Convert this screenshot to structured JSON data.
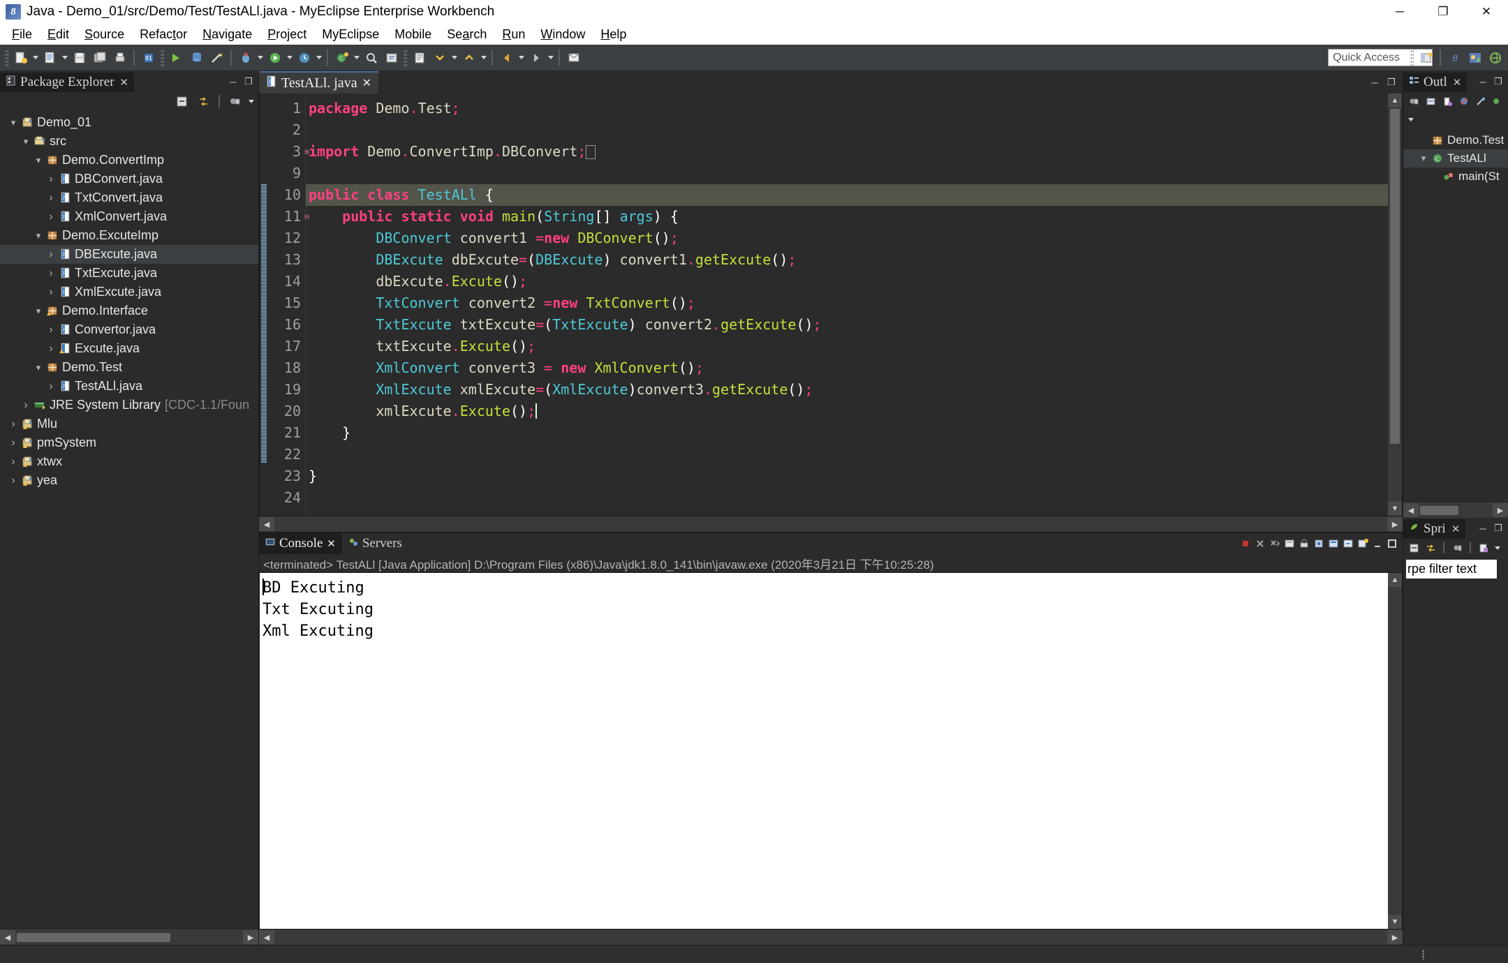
{
  "window": {
    "title": "Java - Demo_01/src/Demo/Test/TestALl.java - MyEclipse Enterprise Workbench",
    "app_icon": "myeclipse-icon",
    "minimize": "─",
    "maximize": "❐",
    "close": "✕"
  },
  "menu": [
    {
      "label": "File",
      "accel": "F"
    },
    {
      "label": "Edit",
      "accel": "E"
    },
    {
      "label": "Source",
      "accel": "S"
    },
    {
      "label": "Refactor",
      "accel": "t"
    },
    {
      "label": "Navigate",
      "accel": "N"
    },
    {
      "label": "Project",
      "accel": "P"
    },
    {
      "label": "MyEclipse",
      "accel": ""
    },
    {
      "label": "Mobile",
      "accel": ""
    },
    {
      "label": "Search",
      "accel": "a"
    },
    {
      "label": "Run",
      "accel": "R"
    },
    {
      "label": "Window",
      "accel": "W"
    },
    {
      "label": "Help",
      "accel": "H"
    }
  ],
  "toolbar": {
    "quick_access_placeholder": "Quick Access"
  },
  "package_explorer": {
    "tab_label": "Package Explorer",
    "close_glyph": "✕",
    "minimize_glyph": "─",
    "maximize_glyph": "❐",
    "tree": [
      {
        "label": "Demo_01",
        "indent": 0,
        "state": "open",
        "icon": "project-icon",
        "selected": false,
        "suffix": ""
      },
      {
        "label": "src",
        "indent": 1,
        "state": "open",
        "icon": "source-folder-icon",
        "selected": false,
        "suffix": ""
      },
      {
        "label": "Demo.ConvertImp",
        "indent": 2,
        "state": "open",
        "icon": "package-icon",
        "selected": false,
        "suffix": ""
      },
      {
        "label": "DBConvert.java",
        "indent": 3,
        "state": "closed",
        "icon": "java-file-icon",
        "selected": false,
        "suffix": ""
      },
      {
        "label": "TxtConvert.java",
        "indent": 3,
        "state": "closed",
        "icon": "java-file-icon",
        "selected": false,
        "suffix": ""
      },
      {
        "label": "XmlConvert.java",
        "indent": 3,
        "state": "closed",
        "icon": "java-file-icon",
        "selected": false,
        "suffix": ""
      },
      {
        "label": "Demo.ExcuteImp",
        "indent": 2,
        "state": "open",
        "icon": "package-icon",
        "selected": false,
        "suffix": ""
      },
      {
        "label": "DBExcute.java",
        "indent": 3,
        "state": "closed",
        "icon": "java-file-icon",
        "selected": true,
        "suffix": ""
      },
      {
        "label": "TxtExcute.java",
        "indent": 3,
        "state": "closed",
        "icon": "java-file-icon",
        "selected": false,
        "suffix": ""
      },
      {
        "label": "XmlExcute.java",
        "indent": 3,
        "state": "closed",
        "icon": "java-file-icon",
        "selected": false,
        "suffix": ""
      },
      {
        "label": "Demo.Interface",
        "indent": 2,
        "state": "open",
        "icon": "package-warn-icon",
        "selected": false,
        "suffix": ""
      },
      {
        "label": "Convertor.java",
        "indent": 3,
        "state": "closed",
        "icon": "java-file-icon",
        "selected": false,
        "suffix": ""
      },
      {
        "label": "Excute.java",
        "indent": 3,
        "state": "closed",
        "icon": "java-file-warn-icon",
        "selected": false,
        "suffix": ""
      },
      {
        "label": "Demo.Test",
        "indent": 2,
        "state": "open",
        "icon": "package-icon",
        "selected": false,
        "suffix": ""
      },
      {
        "label": "TestALl.java",
        "indent": 3,
        "state": "closed",
        "icon": "java-file-icon",
        "selected": false,
        "suffix": ""
      },
      {
        "label": "JRE System Library",
        "indent": 1,
        "state": "closed",
        "icon": "library-icon",
        "selected": false,
        "suffix": "[CDC-1.1/Foun"
      },
      {
        "label": "Mlu",
        "indent": 0,
        "state": "closed",
        "icon": "project-warn-icon",
        "selected": false,
        "suffix": ""
      },
      {
        "label": "pmSystem",
        "indent": 0,
        "state": "closed",
        "icon": "project-warn-icon",
        "selected": false,
        "suffix": ""
      },
      {
        "label": "xtwx",
        "indent": 0,
        "state": "closed",
        "icon": "project-warn-icon",
        "selected": false,
        "suffix": ""
      },
      {
        "label": "yea",
        "indent": 0,
        "state": "closed",
        "icon": "project-warn-icon",
        "selected": false,
        "suffix": ""
      }
    ]
  },
  "editor": {
    "tab_label": "TestALl. java",
    "tab_icon": "java-file-icon",
    "close_glyph": "✕",
    "lines": [
      {
        "num": "1",
        "fold": "",
        "highlight": false,
        "tokens": [
          {
            "t": "package",
            "c": "kw"
          },
          {
            "t": " Demo",
            "c": "plain"
          },
          {
            "t": ".",
            "c": "semi"
          },
          {
            "t": "Test",
            "c": "plain"
          },
          {
            "t": ";",
            "c": "semi"
          }
        ]
      },
      {
        "num": "2",
        "fold": "",
        "highlight": false,
        "tokens": []
      },
      {
        "num": "3",
        "fold": "+",
        "highlight": false,
        "tokens": [
          {
            "t": "import",
            "c": "kw"
          },
          {
            "t": " Demo",
            "c": "plain"
          },
          {
            "t": ".",
            "c": "semi"
          },
          {
            "t": "ConvertImp",
            "c": "plain"
          },
          {
            "t": ".",
            "c": "semi"
          },
          {
            "t": "DBConvert",
            "c": "plain"
          },
          {
            "t": ";",
            "c": "semi"
          },
          {
            "t": "⎕",
            "c": "box"
          }
        ]
      },
      {
        "num": "9",
        "fold": "",
        "highlight": false,
        "tokens": []
      },
      {
        "num": "10",
        "fold": "",
        "highlight": true,
        "tokens": [
          {
            "t": "public class",
            "c": "kw"
          },
          {
            "t": " ",
            "c": "plain"
          },
          {
            "t": "TestALl",
            "c": "type"
          },
          {
            "t": " {",
            "c": "punct"
          }
        ]
      },
      {
        "num": "11",
        "fold": "-",
        "highlight": false,
        "tokens": [
          {
            "t": "    ",
            "c": "plain"
          },
          {
            "t": "public static void",
            "c": "kw"
          },
          {
            "t": " ",
            "c": "plain"
          },
          {
            "t": "main",
            "c": "meth"
          },
          {
            "t": "(",
            "c": "punct"
          },
          {
            "t": "String",
            "c": "type"
          },
          {
            "t": "[] ",
            "c": "punct"
          },
          {
            "t": "args",
            "c": "type"
          },
          {
            "t": ") {",
            "c": "punct"
          }
        ]
      },
      {
        "num": "12",
        "fold": "",
        "highlight": false,
        "tokens": [
          {
            "t": "        ",
            "c": "plain"
          },
          {
            "t": "DBConvert",
            "c": "type"
          },
          {
            "t": " convert1 ",
            "c": "plain"
          },
          {
            "t": "=",
            "c": "semi"
          },
          {
            "t": "new",
            "c": "kw"
          },
          {
            "t": " ",
            "c": "plain"
          },
          {
            "t": "DBConvert",
            "c": "meth"
          },
          {
            "t": "()",
            "c": "punct"
          },
          {
            "t": ";",
            "c": "semi"
          }
        ]
      },
      {
        "num": "13",
        "fold": "",
        "highlight": false,
        "tokens": [
          {
            "t": "        ",
            "c": "plain"
          },
          {
            "t": "DBExcute",
            "c": "type"
          },
          {
            "t": " dbExcute",
            "c": "plain"
          },
          {
            "t": "=",
            "c": "semi"
          },
          {
            "t": "(",
            "c": "punct"
          },
          {
            "t": "DBExcute",
            "c": "type"
          },
          {
            "t": ") ",
            "c": "punct"
          },
          {
            "t": "convert1",
            "c": "plain"
          },
          {
            "t": ".",
            "c": "semi"
          },
          {
            "t": "getExcute",
            "c": "meth"
          },
          {
            "t": "()",
            "c": "punct"
          },
          {
            "t": ";",
            "c": "semi"
          }
        ]
      },
      {
        "num": "14",
        "fold": "",
        "highlight": false,
        "tokens": [
          {
            "t": "        ",
            "c": "plain"
          },
          {
            "t": "dbExcute",
            "c": "plain"
          },
          {
            "t": ".",
            "c": "semi"
          },
          {
            "t": "Excute",
            "c": "meth"
          },
          {
            "t": "()",
            "c": "punct"
          },
          {
            "t": ";",
            "c": "semi"
          }
        ]
      },
      {
        "num": "15",
        "fold": "",
        "highlight": false,
        "tokens": [
          {
            "t": "        ",
            "c": "plain"
          },
          {
            "t": "TxtConvert",
            "c": "type"
          },
          {
            "t": " convert2 ",
            "c": "plain"
          },
          {
            "t": "=",
            "c": "semi"
          },
          {
            "t": "new",
            "c": "kw"
          },
          {
            "t": " ",
            "c": "plain"
          },
          {
            "t": "TxtConvert",
            "c": "meth"
          },
          {
            "t": "()",
            "c": "punct"
          },
          {
            "t": ";",
            "c": "semi"
          }
        ]
      },
      {
        "num": "16",
        "fold": "",
        "highlight": false,
        "tokens": [
          {
            "t": "        ",
            "c": "plain"
          },
          {
            "t": "TxtExcute",
            "c": "type"
          },
          {
            "t": " txtExcute",
            "c": "plain"
          },
          {
            "t": "=",
            "c": "semi"
          },
          {
            "t": "(",
            "c": "punct"
          },
          {
            "t": "TxtExcute",
            "c": "type"
          },
          {
            "t": ") ",
            "c": "punct"
          },
          {
            "t": "convert2",
            "c": "plain"
          },
          {
            "t": ".",
            "c": "semi"
          },
          {
            "t": "getExcute",
            "c": "meth"
          },
          {
            "t": "()",
            "c": "punct"
          },
          {
            "t": ";",
            "c": "semi"
          }
        ]
      },
      {
        "num": "17",
        "fold": "",
        "highlight": false,
        "tokens": [
          {
            "t": "        ",
            "c": "plain"
          },
          {
            "t": "txtExcute",
            "c": "plain"
          },
          {
            "t": ".",
            "c": "semi"
          },
          {
            "t": "Excute",
            "c": "meth"
          },
          {
            "t": "()",
            "c": "punct"
          },
          {
            "t": ";",
            "c": "semi"
          }
        ]
      },
      {
        "num": "18",
        "fold": "",
        "highlight": false,
        "tokens": [
          {
            "t": "        ",
            "c": "plain"
          },
          {
            "t": "XmlConvert",
            "c": "type"
          },
          {
            "t": " convert3 ",
            "c": "plain"
          },
          {
            "t": "= ",
            "c": "semi"
          },
          {
            "t": "new",
            "c": "kw"
          },
          {
            "t": " ",
            "c": "plain"
          },
          {
            "t": "XmlConvert",
            "c": "meth"
          },
          {
            "t": "()",
            "c": "punct"
          },
          {
            "t": ";",
            "c": "semi"
          }
        ]
      },
      {
        "num": "19",
        "fold": "",
        "highlight": false,
        "tokens": [
          {
            "t": "        ",
            "c": "plain"
          },
          {
            "t": "XmlExcute",
            "c": "type"
          },
          {
            "t": " xmlExcute",
            "c": "plain"
          },
          {
            "t": "=",
            "c": "semi"
          },
          {
            "t": "(",
            "c": "punct"
          },
          {
            "t": "XmlExcute",
            "c": "type"
          },
          {
            "t": ")",
            "c": "punct"
          },
          {
            "t": "convert3",
            "c": "plain"
          },
          {
            "t": ".",
            "c": "semi"
          },
          {
            "t": "getExcute",
            "c": "meth"
          },
          {
            "t": "()",
            "c": "punct"
          },
          {
            "t": ";",
            "c": "semi"
          }
        ]
      },
      {
        "num": "20",
        "fold": "",
        "highlight": false,
        "tokens": [
          {
            "t": "        ",
            "c": "plain"
          },
          {
            "t": "xmlExcute",
            "c": "plain"
          },
          {
            "t": ".",
            "c": "semi"
          },
          {
            "t": "Excute",
            "c": "meth"
          },
          {
            "t": "()",
            "c": "punct"
          },
          {
            "t": ";",
            "c": "semi"
          },
          {
            "t": "|",
            "c": "caret"
          }
        ]
      },
      {
        "num": "21",
        "fold": "",
        "highlight": false,
        "tokens": [
          {
            "t": "    }",
            "c": "punct"
          }
        ]
      },
      {
        "num": "22",
        "fold": "",
        "highlight": false,
        "tokens": []
      },
      {
        "num": "23",
        "fold": "",
        "highlight": false,
        "tokens": [
          {
            "t": "}",
            "c": "punct"
          }
        ]
      },
      {
        "num": "24",
        "fold": "",
        "highlight": false,
        "tokens": []
      }
    ]
  },
  "console": {
    "tabs": [
      {
        "label": "Console",
        "active": true,
        "icon": "console-icon",
        "close": "✕"
      },
      {
        "label": "Servers",
        "active": false,
        "icon": "servers-icon",
        "close": ""
      }
    ],
    "status_line": "<terminated> TestALl [Java Application] D:\\Program Files (x86)\\Java\\jdk1.8.0_141\\bin\\javaw.exe (2020年3月21日 下午10:25:28)",
    "output": [
      "BD Excuting",
      "Txt Excuting",
      "Xml Excuting"
    ]
  },
  "outline": {
    "tab_label": "Outl",
    "close_glyph": "✕",
    "items": [
      {
        "label": "Demo.Test",
        "indent": 1,
        "state": "none",
        "icon": "package-icon",
        "selected": false
      },
      {
        "label": "TestALl",
        "indent": 1,
        "state": "open",
        "icon": "class-icon",
        "selected": true
      },
      {
        "label": "main(St",
        "indent": 2,
        "state": "none",
        "icon": "method-icon",
        "selected": false
      }
    ]
  },
  "spring": {
    "tab_label": "Spri",
    "close_glyph": "✕",
    "filter_text": "rpe filter text"
  }
}
